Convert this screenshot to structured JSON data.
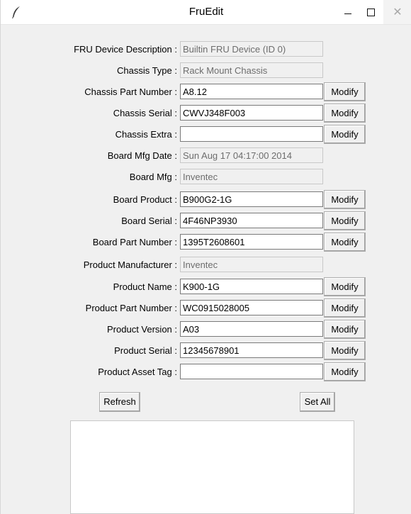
{
  "window": {
    "title": "FruEdit",
    "close_glyph": "✕"
  },
  "fields": [
    {
      "label": "FRU Device Description :",
      "value": "Builtin FRU Device (ID 0)",
      "readonly": true,
      "modify": ""
    },
    {
      "label": "Chassis Type :",
      "value": "Rack Mount Chassis",
      "readonly": true,
      "modify": ""
    },
    {
      "label": "Chassis Part Number :",
      "value": "A8.12",
      "readonly": false,
      "modify": "Modify"
    },
    {
      "label": "Chassis Serial :",
      "value": "CWVJ348F003",
      "readonly": false,
      "modify": "Modify"
    },
    {
      "label": "Chassis Extra :",
      "value": "",
      "readonly": false,
      "modify": "Modify"
    },
    {
      "label": "Board Mfg Date :",
      "value": "Sun Aug 17 04:17:00 2014",
      "readonly": true,
      "modify": ""
    },
    {
      "label": "Board Mfg :",
      "value": "Inventec",
      "readonly": true,
      "modify": ""
    },
    {
      "label": "Board Product :",
      "value": "B900G2-1G",
      "readonly": false,
      "modify": "Modify"
    },
    {
      "label": "Board Serial :",
      "value": "4F46NP3930",
      "readonly": false,
      "modify": "Modify"
    },
    {
      "label": "Board Part Number :",
      "value": "1395T2608601",
      "readonly": false,
      "modify": "Modify"
    },
    {
      "label": "Product Manufacturer :",
      "value": "Inventec",
      "readonly": true,
      "modify": ""
    },
    {
      "label": "Product Name :",
      "value": "K900-1G",
      "readonly": false,
      "modify": "Modify"
    },
    {
      "label": "Product Part Number :",
      "value": "WC0915028005",
      "readonly": false,
      "modify": "Modify"
    },
    {
      "label": "Product Version :",
      "value": "A03",
      "readonly": false,
      "modify": "Modify"
    },
    {
      "label": "Product Serial :",
      "value": "12345678901",
      "readonly": false,
      "modify": "Modify"
    },
    {
      "label": "Product Asset Tag :",
      "value": "",
      "readonly": false,
      "modify": "Modify"
    }
  ],
  "actions": {
    "refresh_label": "Refresh",
    "set_all_label": "Set All"
  },
  "output": {
    "text": ""
  },
  "colors": {
    "background": "#f0f0f0",
    "titlebar": "#ffffff",
    "readonly_text": "#6d6d6d"
  }
}
